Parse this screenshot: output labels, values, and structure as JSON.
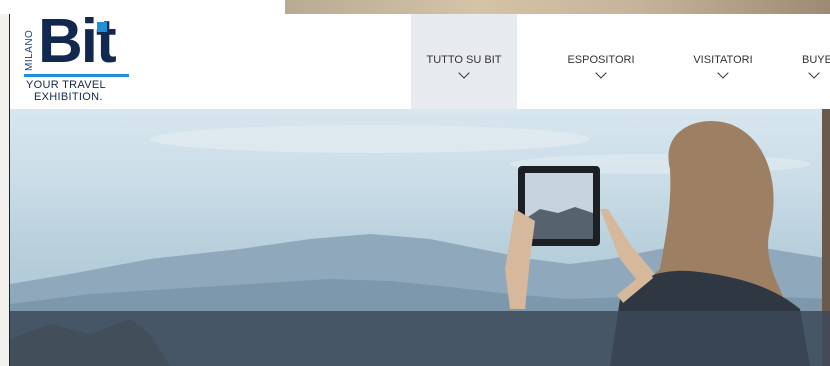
{
  "logo": {
    "city": "MILANO",
    "brand": "Bit",
    "tagline_line1": "YOUR TRAVEL",
    "tagline_line2": "EXHIBITION."
  },
  "nav": {
    "items": [
      {
        "label": "TUTTO SU BIT",
        "active": true
      },
      {
        "label": "ESPOSITORI",
        "active": false
      },
      {
        "label": "VISITATORI",
        "active": false
      },
      {
        "label": "BUYE",
        "active": false
      }
    ]
  },
  "colors": {
    "brand_navy": "#12284f",
    "brand_blue": "#1f8fd6",
    "nav_active_bg": "#e7eaee",
    "hero_band": "#3c4858"
  },
  "icons": {
    "nav_dropdown": "chevron-down-icon"
  }
}
